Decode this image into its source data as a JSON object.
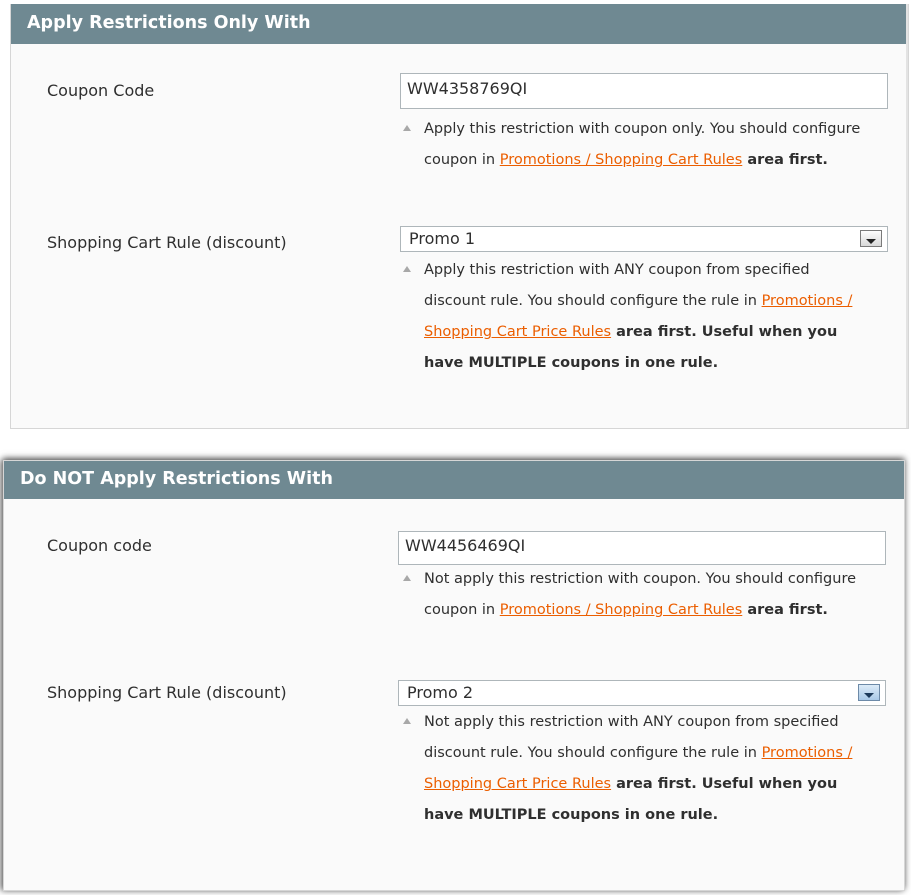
{
  "sections": [
    {
      "title": "Apply Restrictions Only With",
      "coupon_label": "Coupon Code",
      "coupon_value": "WW4358769QI",
      "coupon_note_pre": "Apply this restriction with coupon only. You should configure coupon in ",
      "coupon_note_link": "Promotions / Shopping Cart Rules",
      "coupon_note_post": " area first.",
      "rule_label": "Shopping Cart Rule (discount)",
      "rule_value": "Promo 1",
      "rule_note_pre": "Apply this restriction with ANY coupon from specified discount rule. You should configure the rule in ",
      "rule_note_link": "Promotions / Shopping Cart Price Rules",
      "rule_note_post": " area first. Useful when you have MULTIPLE coupons in one rule."
    },
    {
      "title": "Do NOT Apply Restrictions With",
      "coupon_label": "Coupon code",
      "coupon_value": "WW4456469QI",
      "coupon_note_pre": "Not apply this restriction with coupon. You should configure coupon in ",
      "coupon_note_link": "Promotions / Shopping Cart Rules",
      "coupon_note_post": " area first.",
      "rule_label": "Shopping Cart Rule (discount)",
      "rule_value": "Promo 2",
      "rule_note_pre": "Not apply this restriction with ANY coupon from specified discount rule. You should configure the rule in ",
      "rule_note_link": "Promotions / Shopping Cart Price Rules",
      "rule_note_post": " area first. Useful when you have MULTIPLE coupons in one rule."
    }
  ],
  "icons": {
    "note_marker": "triangle-up-icon",
    "dropdown": "chevron-down-icon"
  },
  "colors": {
    "header_bg": "#6f8992",
    "link": "#eb5e00",
    "panel_bg": "#fafafa"
  }
}
